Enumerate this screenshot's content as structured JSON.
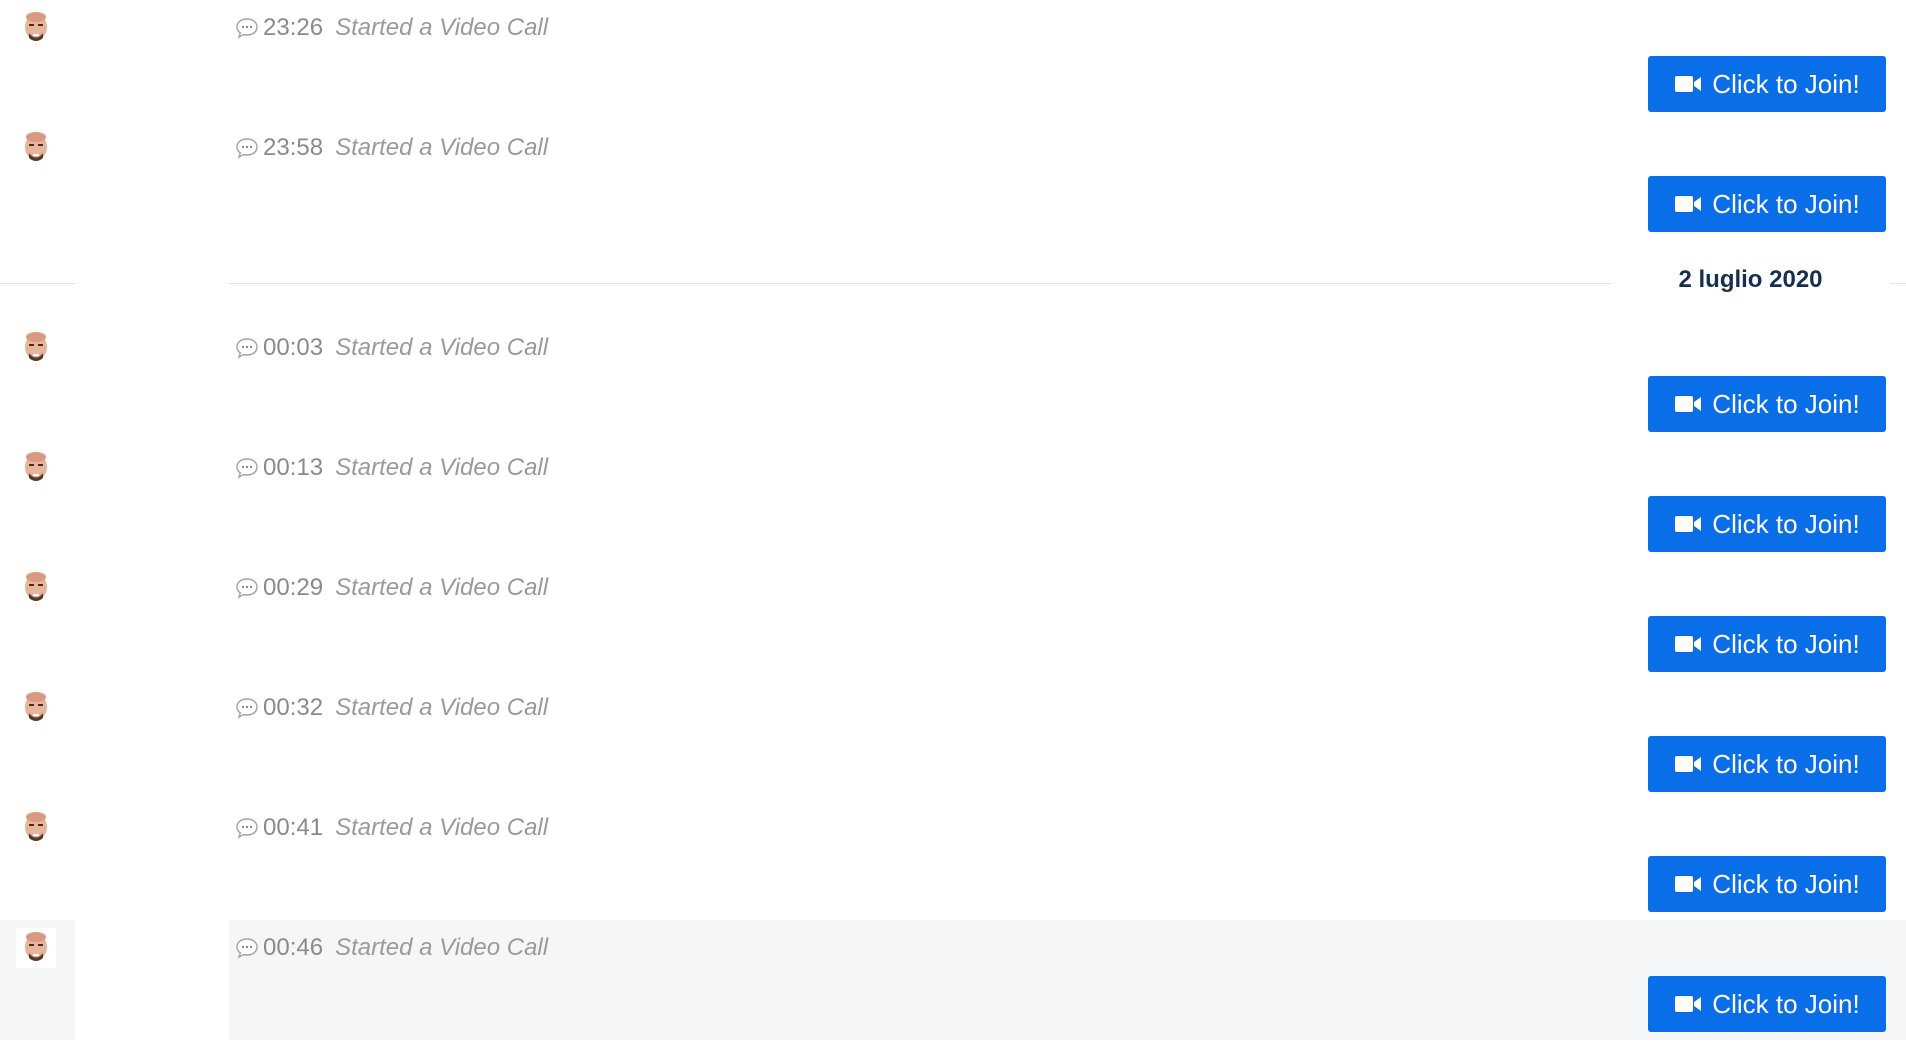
{
  "date_divider": {
    "label": "2 luglio 2020"
  },
  "messages": [
    {
      "time": "23:26",
      "action": "Started a Video Call",
      "join_label": "Click to Join!"
    },
    {
      "time": "23:58",
      "action": "Started a Video Call",
      "join_label": "Click to Join!"
    },
    {
      "time": "00:03",
      "action": "Started a Video Call",
      "join_label": "Click to Join!"
    },
    {
      "time": "00:13",
      "action": "Started a Video Call",
      "join_label": "Click to Join!"
    },
    {
      "time": "00:29",
      "action": "Started a Video Call",
      "join_label": "Click to Join!"
    },
    {
      "time": "00:32",
      "action": "Started a Video Call",
      "join_label": "Click to Join!"
    },
    {
      "time": "00:41",
      "action": "Started a Video Call",
      "join_label": "Click to Join!"
    },
    {
      "time": "00:46",
      "action": "Started a Video Call",
      "join_label": "Click to Join!"
    }
  ],
  "icons": {
    "avatar": "memoji-avatar-icon",
    "message": "chat-bubble-icon",
    "join": "video-camera-icon"
  },
  "colors": {
    "join_button": "#0a6ee8",
    "date_label": "#14304f",
    "highlight_row": "#f5f6f8",
    "meta_text": "#8d8d8d"
  }
}
